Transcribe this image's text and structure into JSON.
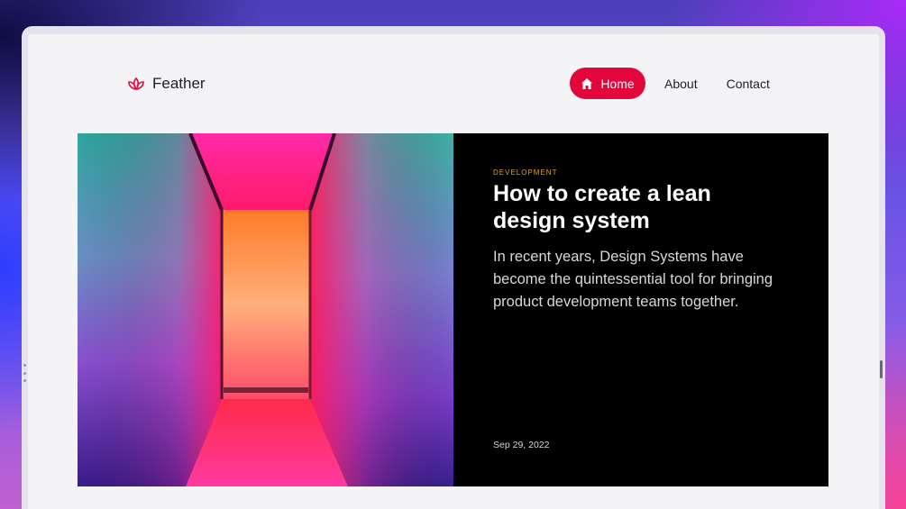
{
  "brand": {
    "name": "Feather",
    "logo_icon": "lotus-icon",
    "accent_color": "#e3063b"
  },
  "nav": {
    "home": {
      "label": "Home",
      "icon": "home-icon"
    },
    "about": {
      "label": "About"
    },
    "contact": {
      "label": "Contact"
    }
  },
  "featured_post": {
    "category": "DEVELOPMENT",
    "title": "How to create a lean design system",
    "excerpt": "In recent years, Design Systems have become the quintessential tool for bringing product development teams together.",
    "date": "Sep 29, 2022",
    "image": "neon-corridor-image"
  }
}
